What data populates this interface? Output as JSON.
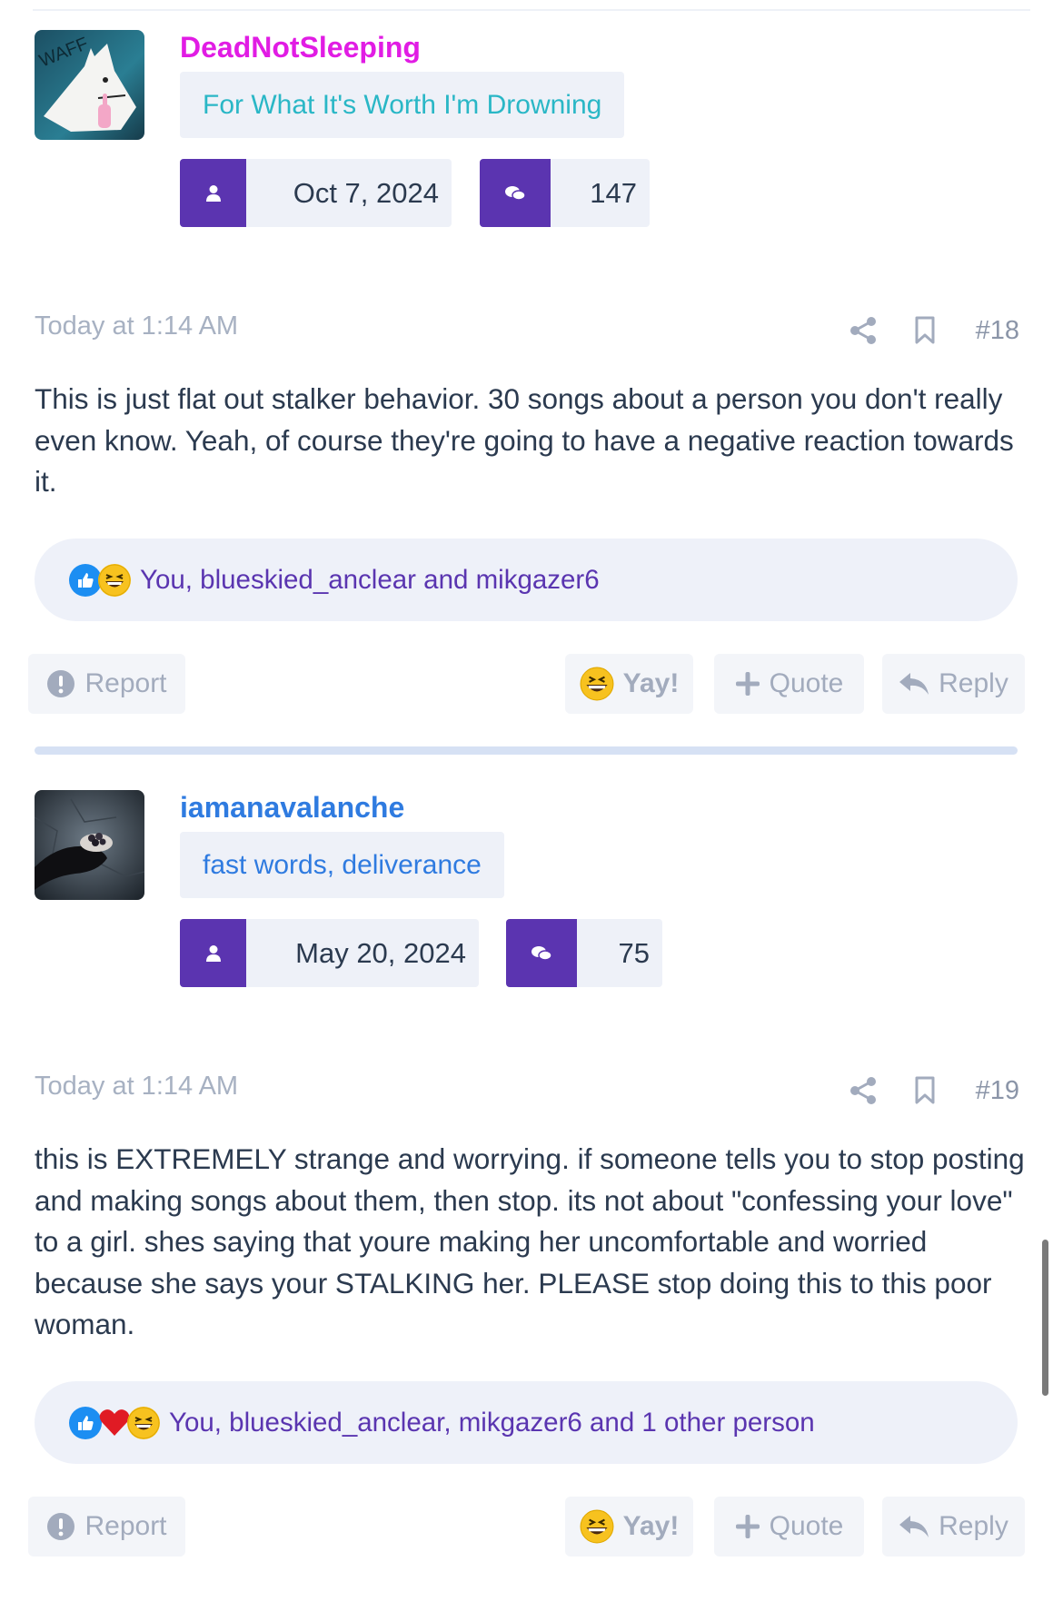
{
  "posts": [
    {
      "author": {
        "username": "DeadNotSleeping",
        "username_color": "#e11ce4",
        "user_title": "For What It's Worth I'm Drowning",
        "user_title_color": "#2ab7c6",
        "joined": "Oct 7, 2024",
        "messages": "147",
        "avatar_text": "WAFF"
      },
      "date": "Today at 1:14 AM",
      "post_number": "#18",
      "message": "This is just flat out stalker behavior. 30 songs about a person you don't really even know. Yeah, of course they're going to have a negative reaction towards it.",
      "reactions": {
        "icons": [
          "like-icon",
          "laugh-icon"
        ],
        "text": "You, blueskied_anclear and mikgazer6"
      }
    },
    {
      "author": {
        "username": "iamanavalanche",
        "username_color": "#2f7be0",
        "user_title": "fast words, deliverance",
        "user_title_color": "#2f7be0",
        "joined": "May 20, 2024",
        "messages": "75"
      },
      "date": "Today at 1:14 AM",
      "post_number": "#19",
      "message": "this is EXTREMELY strange and worrying. if someone tells you to stop posting and making songs about them, then stop. its not about \"confessing your love\" to a girl. shes saying that youre making her uncomfortable and worried because she says your STALKING her. PLEASE stop doing this to this poor woman.",
      "reactions": {
        "icons": [
          "like-icon",
          "love-icon",
          "laugh-icon"
        ],
        "text": "You, blueskied_anclear, mikgazer6 and 1 other person"
      }
    }
  ],
  "actions": {
    "report": "Report",
    "yay": "Yay!",
    "quote": "Quote",
    "reply": "Reply"
  },
  "colors": {
    "accent": "#5b34b0",
    "reaction_text": "#5a35b0",
    "muted": "#a2abbd"
  }
}
